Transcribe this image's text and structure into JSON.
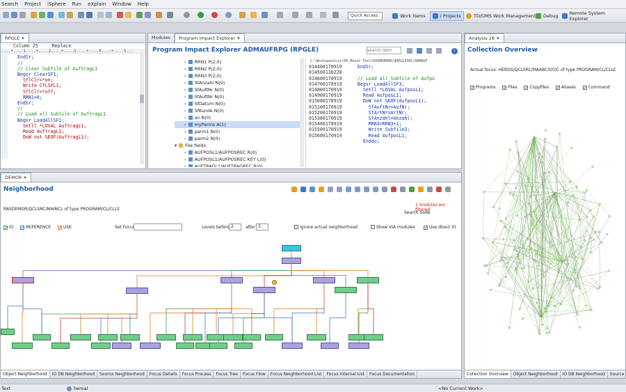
{
  "menu": [
    "Search",
    "Project",
    "iSphere",
    "Run",
    "eXplain",
    "Window",
    "Help"
  ],
  "toolbar": {
    "quick_access": "Quick Access"
  },
  "perspectives": [
    {
      "label": "Work Items",
      "active": false,
      "color": "#3c78c8"
    },
    {
      "label": "i Projects",
      "active": true,
      "color": "#3c78c8"
    },
    {
      "label": "TD/OMS Work Management",
      "active": false,
      "color": "#e0a020"
    },
    {
      "label": "Debug",
      "active": false,
      "color": "#4aa04a"
    },
    {
      "label": "Remote System Explorer",
      "active": false,
      "color": "#3c78c8"
    }
  ],
  "editor": {
    "tab": "RPGLE",
    "ruler_status": "Column 25     Replace",
    "ruler": "....+....1....+....2....+....3....+....4....+....5...",
    "lines": [
      {
        "t": "EndSr;",
        "c": "bl"
      },
      {
        "t": "//",
        "c": "cm"
      },
      {
        "t": "// Clear Subfile of AuftragL1",
        "c": "cm"
      },
      {
        "t": "Begsr ClearSF1;",
        "c": "bl"
      },
      {
        "t": "  SflClr=*on;",
        "c": "kw"
      },
      {
        "t": "  Write CTLSFL1;",
        "c": "kw"
      },
      {
        "t": "  SflClr=*off;",
        "c": "kw"
      },
      {
        "t": "  RRN1=0;",
        "c": "bl"
      },
      {
        "t": "EndSr;",
        "c": "bl"
      },
      {
        "t": "//",
        "c": "cm"
      },
      {
        "t": "// Load all Subfile of AuftragL1",
        "c": "cm"
      },
      {
        "t": "Begsr LoadAllSF1;",
        "c": "bl"
      },
      {
        "t": "  Setll *LOVAL AuftragL1;",
        "c": "kw"
      },
      {
        "t": "  Read AuftragL1;",
        "c": "kw"
      },
      {
        "t": "  DoW not %EOF(AuftragL1);",
        "c": "kw"
      }
    ]
  },
  "impact": {
    "tabs": [
      "Modules",
      "Program Impact Explorer"
    ],
    "title": "Program Impact Explorer ADMAUFRPG (RPGLE)",
    "search_placeholder": "search item",
    "tree": [
      {
        "label": "RRN1 P(2,0)",
        "level": 1,
        "sel": false
      },
      {
        "label": "RRN2 P(2,0)",
        "level": 1,
        "sel": false
      },
      {
        "label": "RRN3 P(2,0)",
        "level": 1,
        "sel": false
      },
      {
        "label": "SfAnzahl N(0)",
        "level": 1,
        "sel": false
      },
      {
        "label": "SfAuftNr N(0)",
        "level": 1,
        "sel": false
      },
      {
        "label": "SfAuftNr N(0)",
        "level": 1,
        "sel": false
      },
      {
        "label": "SfDatum N(0)",
        "level": 1,
        "sel": false
      },
      {
        "label": "SfKunde N(0)",
        "level": 1,
        "sel": false
      },
      {
        "label": "av N(0)",
        "level": 1,
        "sel": false
      },
      {
        "label": "myParms A(1)",
        "level": 1,
        "sel": true
      },
      {
        "label": "parm1 N(0)",
        "level": 1,
        "sel": false
      },
      {
        "label": "parm2 N(0)",
        "level": 1,
        "sel": false
      },
      {
        "label": "File fields",
        "level": 0,
        "sel": false
      },
      {
        "label": "AUFPOSL1/AUFPOSREC R(0)",
        "level": 1,
        "sel": false
      },
      {
        "label": "AUFPOSL1/AUFPOSREC KEY L(0)",
        "level": 1,
        "sel": false
      },
      {
        "label": "AUFTRAGL1/AUFTRAGREC R(0)",
        "level": 1,
        "sel": false
      }
    ],
    "path": "C:\\Workspace\\xx\\00_Mount Test/RASMDEMOR/QRPGLESRC/ADMAUF",
    "code": [
      {
        "n": "014400170919",
        "t": "   EndSr;",
        "c": "bl"
      },
      {
        "n": "014500130228",
        "t": "",
        "c": "bl"
      },
      {
        "n": "014600170919",
        "t": "   // Load all Subfile of Aufpo",
        "c": "cm"
      },
      {
        "n": "014700170919",
        "t": "   Begsr LoadAllSF3;",
        "c": "bl"
      },
      {
        "n": "014800170919",
        "t": "     Setll *LOVAL AufposL1;",
        "c": "bl"
      },
      {
        "n": "014900170919",
        "t": "     Read AufposL1;",
        "c": "bl"
      },
      {
        "n": "015000170919",
        "t": "     DoW not %EOF(AufposL1);",
        "c": "bl"
      },
      {
        "n": "015100170919",
        "t": "       SfAuftNr=AufNr;",
        "c": "bl"
      },
      {
        "n": "015200170919",
        "t": "       SfArtNr=ArtNr;",
        "c": "bl"
      },
      {
        "n": "015300170919",
        "t": "       SfAnzahl=Anzahl;",
        "c": "bl"
      },
      {
        "n": "015400170919",
        "t": "       RRN3=RRN3+1;",
        "c": "bl"
      },
      {
        "n": "015500170919",
        "t": "       Write Subfile3;",
        "c": "bl"
      },
      {
        "n": "015600170919",
        "t": "       Read AufposL1;",
        "c": "bl"
      },
      {
        "n": "",
        "t": "     Enddo;",
        "c": "bl"
      }
    ]
  },
  "analysis": {
    "tab": "Analysis 26",
    "title": "Collection Overview",
    "focus": "Actual focus: HEROS/QCLSRC/MAABC0(0)C of type PROGRAM/CL/CLLE",
    "filters": [
      "Programs",
      "Files",
      "Copyfiles",
      "Aliases",
      "Command"
    ],
    "bottom_tabs": [
      "Collection Overview",
      "Object Neighborhood",
      "IO DB Neighborhood",
      "Source Neighborhood"
    ]
  },
  "neighborhood": {
    "tab": "DEMOR",
    "title": "Neighborhood",
    "focus": "RASDEMOR/QCLSRC/MAINCL  of type PROGRAM/CL/CLLE",
    "filtered": "1 modules are filtered",
    "search_node": "Search node",
    "legend": [
      {
        "label": "IO",
        "color": "#2e9c4e"
      },
      {
        "label": "REFERENCE",
        "color": "#3c78c8"
      },
      {
        "label": "USE",
        "color": "#e07a20"
      }
    ],
    "set_focus": "Set Focus",
    "levels_before": "Levels before",
    "levels_before_val": "2",
    "after": "after",
    "after_val": "3",
    "ignore": "Ignore actual neighborhood",
    "show_via": "Show VIA modules",
    "use_direct": "Use direct IO",
    "bottom_tabs": [
      "Object Neighborhood",
      "IO DB Neighborhood",
      "Source Neighborhood",
      "Focus Details",
      "Focus Process",
      "Focus Tree",
      "Focus Flow",
      "Focus Neighborhood List",
      "Focus Internal List",
      "Focus Documentation"
    ]
  },
  "status": {
    "left": "Text",
    "user": "heroal",
    "work": "<No Current Work>"
  }
}
